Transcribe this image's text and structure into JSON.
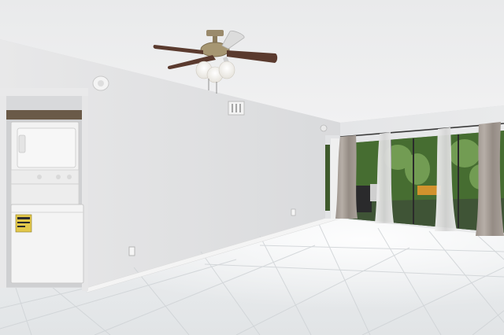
{
  "scene": {
    "ceiling_fan": {
      "icon": "ceiling-fan-icon",
      "light_count": 3,
      "blade_count": 4
    },
    "laundry": {
      "washer_dryer": "stacked-washer-dryer-icon",
      "has_energy_label": true
    },
    "floor": {
      "material": "white-tile",
      "finish": "glossy"
    },
    "colors": {
      "ceiling": "#ecedee",
      "wall_left": "#e4e5e6",
      "wall_back": "#dcdde0",
      "floor": "#e9ecee",
      "baseboard": "#f4f4f4",
      "fan_blade": "#5a3a2e",
      "fan_brass": "#9a8a6c",
      "curtain_grey": "#a79e97",
      "sheer": "#e2e2e2",
      "foliage": "#4d7a36",
      "appliance": "#f2f2f2",
      "energy_label": "#e3c84a"
    }
  }
}
